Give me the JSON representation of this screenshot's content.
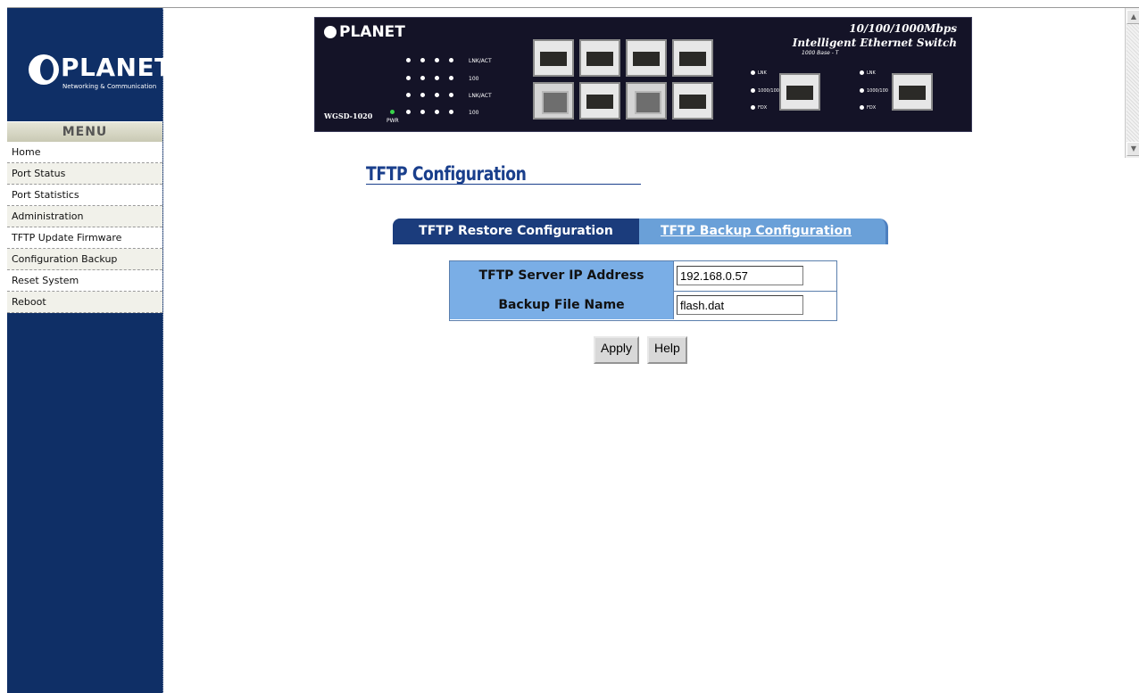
{
  "brand": {
    "name": "PLANET",
    "tagline": "Networking & Communication"
  },
  "sidebar": {
    "menu_title": "MENU",
    "items": [
      {
        "label": "Home"
      },
      {
        "label": "Port Status"
      },
      {
        "label": "Port Statistics"
      },
      {
        "label": "Administration"
      },
      {
        "label": "TFTP Update Firmware"
      },
      {
        "label": "Configuration Backup"
      },
      {
        "label": "Reset System"
      },
      {
        "label": "Reboot"
      }
    ]
  },
  "banner": {
    "brand": "PLANET",
    "model": "WGSD-1020",
    "pwr_label": "PWR",
    "title_line1": "10/100/1000Mbps",
    "title_line2": "Intelligent Ethernet Switch",
    "subtitle": "1000 Base - T",
    "led_labels": [
      "LNK/ACT",
      "100",
      "LNK/ACT",
      "100"
    ],
    "side_labels": [
      "LNK",
      "1000/100",
      "FDX"
    ]
  },
  "page": {
    "title": "TFTP Configuration",
    "tabs": [
      {
        "label": "TFTP Restore Configuration",
        "active": true
      },
      {
        "label": "TFTP Backup Configuration",
        "active": false
      }
    ],
    "form": {
      "server_ip_label": "TFTP Server IP Address",
      "server_ip_value": "192.168.0.57",
      "file_name_label": "Backup File Name",
      "file_name_value": "flash.dat"
    },
    "buttons": {
      "apply": "Apply",
      "help": "Help"
    }
  },
  "colors": {
    "sidebar_bg": "#0f2f66",
    "title_blue": "#1a3f8c",
    "tab_active": "#1b3c7c",
    "tab_inactive": "#6aa0d8",
    "label_bg": "#7aaee6"
  },
  "scrollbar": {
    "up_icon": "arrow-up-icon",
    "down_icon": "arrow-down-icon"
  }
}
